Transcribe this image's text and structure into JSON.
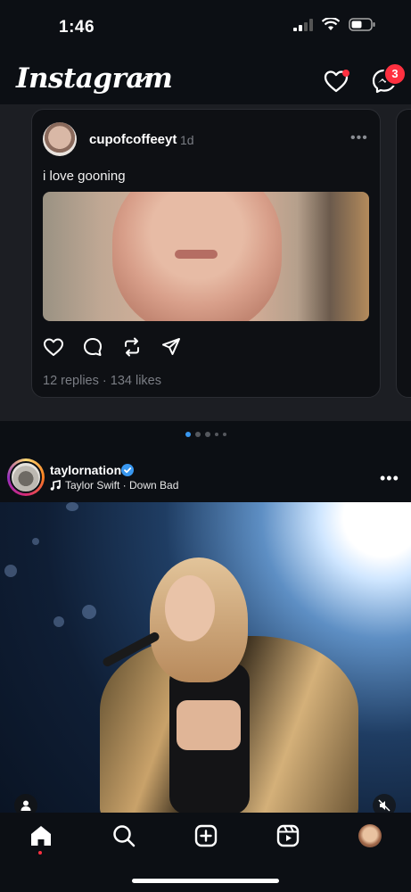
{
  "status_bar": {
    "time": "1:46"
  },
  "header": {
    "logo": "Instagram",
    "notifications_badge": "3",
    "accent": "#ff3040"
  },
  "threads_card": {
    "username": "cupofcoffeeyt",
    "time": "1d",
    "text": "i love gooning",
    "stats": "12 replies · 134 likes",
    "more": "•••"
  },
  "carousel_pager": {
    "count": 5,
    "active_index": 0
  },
  "post": {
    "username": "taylornation",
    "verified": true,
    "audio": "Taylor Swift · Down Bad",
    "more": "•••"
  },
  "bottom_nav": {
    "items": [
      "home-icon",
      "search-icon",
      "create-icon",
      "reels-icon",
      "profile-avatar"
    ],
    "active": "home-icon"
  }
}
